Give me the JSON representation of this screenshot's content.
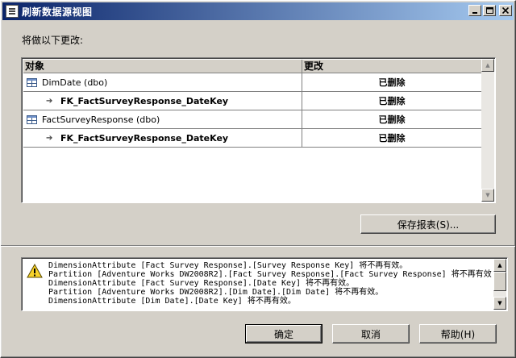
{
  "window": {
    "title": "刷新数据源视图"
  },
  "prompt": "将做以下更改:",
  "grid": {
    "columns": [
      "对象",
      "更改"
    ],
    "rows": [
      {
        "object": "DimDate (dbo)",
        "change": "已删除",
        "level": "table"
      },
      {
        "object": "FK_FactSurveyResponse_DateKey",
        "change": "已删除",
        "level": "child"
      },
      {
        "object": "FactSurveyResponse (dbo)",
        "change": "已删除",
        "level": "table"
      },
      {
        "object": "FK_FactSurveyResponse_DateKey",
        "change": "已删除",
        "level": "child"
      }
    ]
  },
  "save_report_button": "保存报表(S)...",
  "messages": [
    "DimensionAttribute [Fact Survey Response].[Survey Response Key] 将不再有效。",
    "Partition [Adventure Works DW2008R2].[Fact Survey Response].[Fact Survey Response] 将不再有效",
    "DimensionAttribute [Fact Survey Response].[Date Key] 将不再有效。",
    "Partition [Adventure Works DW2008R2].[Dim Date].[Dim Date] 将不再有效。",
    "DimensionAttribute [Dim Date].[Date Key] 将不再有效。"
  ],
  "buttons": {
    "ok": "确定",
    "cancel": "取消",
    "help": "帮助(H)"
  },
  "icons": {
    "app": "document-icon",
    "table": "table-icon",
    "relation": "arrow-icon",
    "warning": "warning-icon"
  },
  "colors": {
    "titlebar_start": "#0a246a",
    "titlebar_end": "#a6caf0",
    "face": "#d4d0c8",
    "warning": "#f7d22a"
  }
}
